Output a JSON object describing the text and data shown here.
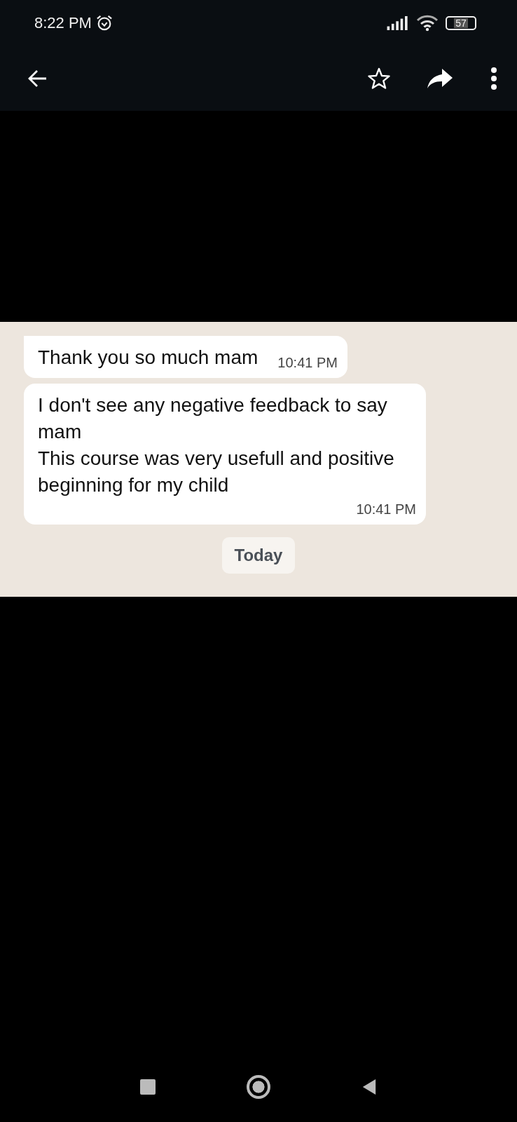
{
  "status_bar": {
    "time": "8:22 PM",
    "battery": "57"
  },
  "messages": [
    {
      "text": "Thank you so much mam",
      "time": "10:41 PM"
    },
    {
      "text": "I don't see any negative feedback to say mam\nThis course was very usefull and positive beginning for my child",
      "time": "10:41 PM"
    }
  ],
  "date_chip": "Today"
}
